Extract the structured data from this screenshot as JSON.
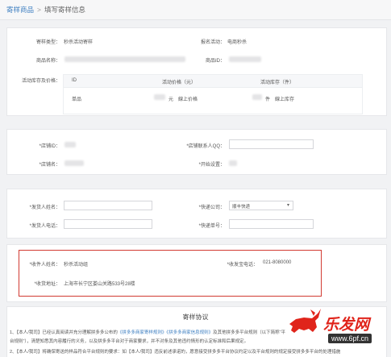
{
  "breadcrumb": {
    "root": "寄样商品",
    "separator": ">",
    "current": "填写寄样信息"
  },
  "info": {
    "type_label": "寄样类型：",
    "type_value": "秒杀活动寄样",
    "signup_label": "报名活动：",
    "signup_value": "电商秒杀",
    "product_name_label": "商品名称：",
    "product_id_label": "商品ID：",
    "stock_price_label": "活动库存及价格：",
    "table_headers": [
      "ID",
      "活动价格（元）",
      "活动库存（件）"
    ],
    "table_row": {
      "col1": "单品",
      "price_unit": "元",
      "price_note": "線上价格",
      "stock_unit": "件",
      "stock_note": "線上库存"
    }
  },
  "store": {
    "store_id_label": "*店铺ID：",
    "contact_qq_label": "*店铺联系人QQ：",
    "store_name_label": "*店铺名：",
    "shop_prefix_label": "*开始设置："
  },
  "sender": {
    "name_label": "*发货人姓名：",
    "express_label": "*快递公司：",
    "express_value": "顺丰快递",
    "phone_label": "*发货人电话：",
    "tracking_label": "*快递单号："
  },
  "receiver": {
    "name_label": "*收件人姓名：",
    "name_value": "秒杀活动组",
    "phone_label": "*收发宝电话：",
    "phone_value": "021-8080000",
    "address_label": "*收货地址：",
    "address_value": "上海市长宁区娄山关路533号28楼"
  },
  "protocol": {
    "title": "寄样协议",
    "line1_a": "1、【本人/我司】已经认真阅读并充分理解拼多多公布的",
    "line1_link": "《拼多多商家寄样规则》《拼多多商家信息规则》",
    "line1_b": "及其他拼多多平台规则（以下简称“平",
    "line1c": "台规则”），清楚知悉其内容履行的义务，以及拼多多平台对于商家要求，并不对条及其他违约情形的认定标准和后果规定。",
    "line2": "2、【本人/我司】将确保寄送的样品符合平台规则的要求：如【本人/我司】违反前述承诺的，愿意接受拼多多平台协议约定以及平台规则的规定接受拼多多平台的处理措施"
  },
  "watermark": {
    "brand": "乐发网",
    "url": "www.6pf.cn"
  },
  "colors": {
    "accent": "#3e7fc1",
    "highlight": "#d23b32",
    "watermark_red": "#e0241b"
  }
}
